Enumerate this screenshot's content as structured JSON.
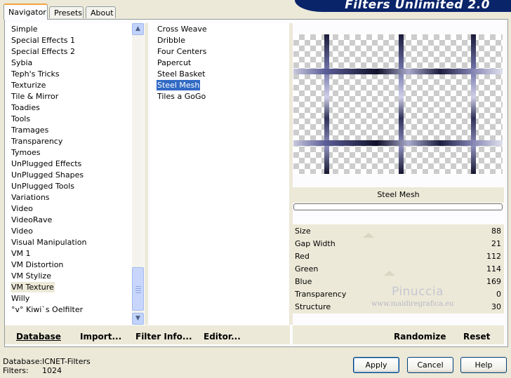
{
  "window": {
    "title": "Filters Unlimited 2.0"
  },
  "tabs": [
    {
      "label": "Navigator",
      "active": true
    },
    {
      "label": "Presets",
      "active": false
    },
    {
      "label": "About",
      "active": false
    }
  ],
  "categories": {
    "items": [
      "Simple",
      "Special Effects 1",
      "Special Effects 2",
      "Sybia",
      "Teph's Tricks",
      "Texturize",
      "Tile & Mirror",
      "Toadies",
      "Tools",
      "Tramages",
      "Transparency",
      "Tymoes",
      "UnPlugged Effects",
      "UnPlugged Shapes",
      "UnPlugged Tools",
      "Variations",
      "Video",
      "VideoRave",
      "Video",
      "Visual Manipulation",
      "VM 1",
      "VM Distortion",
      "VM Stylize",
      "VM Texture",
      "Willy",
      "°v° Kiwi`s Oelfilter"
    ],
    "selected": "VM Texture"
  },
  "filters": {
    "items": [
      "Cross Weave",
      "Dribble",
      "Four Centers",
      "Papercut",
      "Steel Basket",
      "Steel Mesh",
      "Tiles a GoGo"
    ],
    "selected": "Steel Mesh"
  },
  "preview": {
    "filter_name": "Steel Mesh",
    "progress_pct": 0
  },
  "parameters": [
    {
      "label": "Size",
      "value": "88"
    },
    {
      "label": "Gap Width",
      "value": "21"
    },
    {
      "label": "Red",
      "value": "112"
    },
    {
      "label": "Green",
      "value": "114"
    },
    {
      "label": "Blue",
      "value": "169"
    },
    {
      "label": "Transparency",
      "value": "0"
    },
    {
      "label": "Structure",
      "value": "30"
    }
  ],
  "watermark": {
    "name": "Pinuccia",
    "url": "www.maidiregrafica.eu"
  },
  "left_actions": {
    "database": "Database",
    "import": "Import...",
    "filter_info": "Filter Info...",
    "editor": "Editor..."
  },
  "right_actions": {
    "randomize": "Randomize",
    "reset": "Reset"
  },
  "status": {
    "database_label": "Database:",
    "database_value": "ICNET-Filters",
    "filters_label": "Filters:",
    "filters_value": "1024"
  },
  "buttons": {
    "apply": "Apply",
    "cancel": "Cancel",
    "help": "Help"
  }
}
